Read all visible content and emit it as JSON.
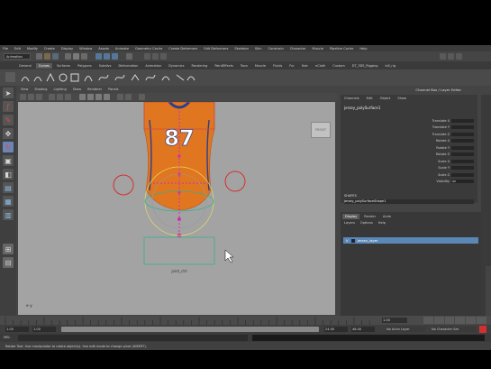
{
  "menubar": [
    "File",
    "Edit",
    "Modify",
    "Create",
    "Display",
    "Window",
    "Assets",
    "Animate",
    "Geometry Cache",
    "Create Deformers",
    "Edit Deformers",
    "Skeleton",
    "Skin",
    "Constrain",
    "Character",
    "Muscle",
    "Pipeline Cache",
    "Help"
  ],
  "status_line": {
    "mode": "Animation"
  },
  "shelf_tabs": [
    "General",
    "Curves",
    "Surfaces",
    "Polygons",
    "Subdivs",
    "Deformation",
    "Animation",
    "Dynamics",
    "Rendering",
    "PaintEffects",
    "Toon",
    "Muscle",
    "Fluids",
    "Fur",
    "Hair",
    "nCloth",
    "Custom",
    "DT_3DS_Rigging",
    "bill_rig"
  ],
  "shelf_active_tab": "Curves",
  "viewport": {
    "menus": [
      "View",
      "Shading",
      "Lighting",
      "Show",
      "Renderer",
      "Panels"
    ],
    "jersey_number": "87",
    "axis_label": "x–y",
    "viewcube_label": "FRONT",
    "root_label": "joint_ctrl",
    "colors": {
      "jersey": "#e0761f",
      "trim": "#2a3f8f",
      "control": "#d43030",
      "root_ctrl": "#38b08a",
      "joints": "#cc33aa"
    }
  },
  "channel_box": {
    "title": "Channel Box / Layer Editor",
    "menus": [
      "Channels",
      "Edit",
      "Object",
      "Show"
    ],
    "object_name": "jersey_polySurface1",
    "attributes": [
      "Translate X",
      "Translate Y",
      "Translate Z",
      "Rotate X",
      "Rotate Y",
      "Rotate Z",
      "Scale X",
      "Scale Y",
      "Scale Z",
      "Visibility"
    ],
    "visibility_value": "on",
    "section_label": "SHAPES",
    "shape_name": "jersey_polySurfaceShape1"
  },
  "layer_editor": {
    "tabs": [
      "Display",
      "Render",
      "Anim"
    ],
    "active_tab": "Display",
    "menus": [
      "Layers",
      "Options",
      "Help"
    ],
    "layer_row": {
      "visible": "V",
      "name": "jersey_layer"
    }
  },
  "time": {
    "start": "1.00",
    "end": "1.00",
    "range_start": "1.00",
    "range_end": "24.00",
    "range_end2": "48.00",
    "current": "1.00",
    "anim_layer": "No Anim Layer",
    "char_set": "No Character Set"
  },
  "command_line": {
    "label": "MEL"
  },
  "help_line": "Rotate Tool: Use manipulator to rotate object(s). Use edit mode to change pivot (INSERT)."
}
